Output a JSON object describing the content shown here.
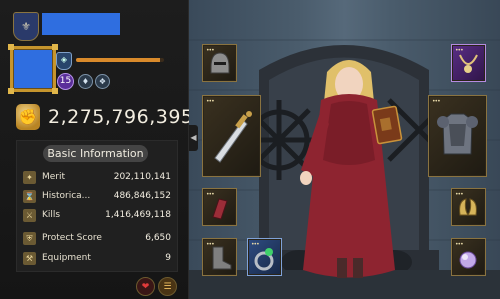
{
  "profile": {
    "power_value": "2,275,796,395",
    "power_progress": 0.95,
    "level_badge": "15"
  },
  "info": {
    "title": "Basic Information",
    "stats": [
      {
        "label": "Merit",
        "value": "202,110,141",
        "icon": "merit-icon"
      },
      {
        "label": "Historica...",
        "value": "486,846,152",
        "icon": "history-icon"
      },
      {
        "label": "Kills",
        "value": "1,416,469,118",
        "icon": "swords-icon"
      },
      {
        "label": "Protect Score",
        "value": "6,650",
        "icon": "shield-icon"
      },
      {
        "label": "Equipment",
        "value": "9",
        "icon": "equipment-icon"
      }
    ]
  },
  "colors": {
    "accent_gold": "#c6952d",
    "placeholder_blue": "#2f6ee0",
    "power_bar": "#d98a2b",
    "robe": "#8e2430"
  },
  "equipment": [
    {
      "slot": "helmet",
      "rarity": "gold",
      "icon": "helmet-icon"
    },
    {
      "slot": "weapon",
      "rarity": "gold",
      "icon": "dagger-icon"
    },
    {
      "slot": "bracers",
      "rarity": "gold",
      "icon": "bracer-icon"
    },
    {
      "slot": "boots",
      "rarity": "gold",
      "icon": "boots-icon"
    },
    {
      "slot": "ring",
      "rarity": "blue",
      "icon": "ring-icon"
    },
    {
      "slot": "necklace",
      "rarity": "purple",
      "icon": "necklace-icon"
    },
    {
      "slot": "armor",
      "rarity": "gold",
      "icon": "armor-icon"
    },
    {
      "slot": "accessory",
      "rarity": "gold",
      "icon": "horns-icon"
    },
    {
      "slot": "orb",
      "rarity": "gold",
      "icon": "orb-icon"
    }
  ]
}
